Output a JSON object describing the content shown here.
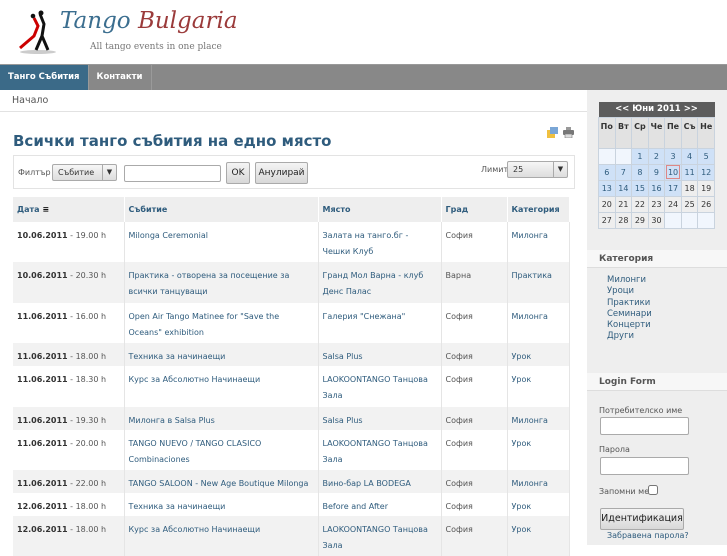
{
  "site": {
    "title_a": "Tango",
    "title_b": "Bulgaria",
    "tagline": "All tango events in one place"
  },
  "nav": [
    {
      "label": "Танго Събития",
      "active": true
    },
    {
      "label": "Контакти",
      "active": false
    }
  ],
  "breadcrumb": "Начало",
  "page_title": "Всички танго събития на едно място",
  "filter": {
    "label": "Филтър",
    "select": "Събитие",
    "input": "",
    "ok": "OK",
    "reset": "Анулирай",
    "limit_label": "Лимит",
    "limit": "25"
  },
  "table": {
    "headers": [
      "Дата",
      "Събитие",
      "Място",
      "Град",
      "Категория"
    ],
    "rows": [
      {
        "date": "10.06.2011",
        "time": "- 19.00 h",
        "event": "Milonga Ceremonial",
        "place": "Залата на танго.бг - Чешки Клуб",
        "city": "София",
        "cat": "Милонга"
      },
      {
        "date": "10.06.2011",
        "time": "- 20.30 h",
        "event": "Практика - отворена за посещение за всички танцуващи",
        "place": "Гранд Мол Варна - клуб Денс Палас",
        "city": "Варна",
        "cat": "Практика"
      },
      {
        "date": "11.06.2011",
        "time": "- 16.00 h",
        "event": "Open Air Tango Matinee for \"Save the Oceans\" exhibition",
        "place": "Галерия \"Снежана\"",
        "city": "София",
        "cat": "Милонга"
      },
      {
        "date": "11.06.2011",
        "time": "- 18.00 h",
        "event": "Техника за начинаещи",
        "place": "Salsa Plus",
        "city": "София",
        "cat": "Урок"
      },
      {
        "date": "11.06.2011",
        "time": "- 18.30 h",
        "event": "Курс за Абсолютно Начинаещи",
        "place": "LAOKOONTANGO Танцова Зала",
        "city": "София",
        "cat": "Урок"
      },
      {
        "date": "11.06.2011",
        "time": "- 19.30 h",
        "event": "Милонга в Salsa Plus",
        "place": "Salsa Plus",
        "city": "София",
        "cat": "Милонга"
      },
      {
        "date": "11.06.2011",
        "time": "- 20.00 h",
        "event": "TANGO NUEVO / TANGO CLASICO Combinaciones",
        "place": "LAOKOONTANGO Танцова Зала",
        "city": "София",
        "cat": "Урок"
      },
      {
        "date": "11.06.2011",
        "time": "- 22.00 h",
        "event": "TANGO SALOON - New Age Boutique Milonga",
        "place": "Вино-бар LA BODEGA",
        "city": "София",
        "cat": "Милонга"
      },
      {
        "date": "12.06.2011",
        "time": "- 18.00 h",
        "event": "Техника за начинаещи",
        "place": "Before and After",
        "city": "София",
        "cat": "Урок"
      },
      {
        "date": "12.06.2011",
        "time": "- 18.00 h",
        "event": "Курс за Абсолютно Начинаещи",
        "place": "LAOKOONTANGO Танцова Зала",
        "city": "София",
        "cat": "Урок"
      }
    ]
  },
  "calendar": {
    "prev": "<<",
    "month": "Юни 2011",
    "next": ">>",
    "days": [
      "По",
      "Вт",
      "Ср",
      "Че",
      "Пе",
      "Съ",
      "Не"
    ],
    "weeks": [
      [
        "",
        "",
        "1",
        "2",
        "3",
        "4",
        "5"
      ],
      [
        "6",
        "7",
        "8",
        "9",
        "10",
        "11",
        "12"
      ],
      [
        "13",
        "14",
        "15",
        "16",
        "17",
        "18",
        "19"
      ],
      [
        "20",
        "21",
        "22",
        "23",
        "24",
        "25",
        "26"
      ],
      [
        "27",
        "28",
        "29",
        "30",
        "",
        "",
        ""
      ]
    ],
    "today": "10",
    "event_days": [
      "1",
      "2",
      "3",
      "4",
      "5",
      "6",
      "7",
      "8",
      "9",
      "10",
      "11",
      "12",
      "13",
      "14",
      "15",
      "16",
      "17"
    ]
  },
  "category": {
    "title": "Категория",
    "items": [
      "Милонги",
      "Уроци",
      "Практики",
      "Семинари",
      "Концерти",
      "Други"
    ]
  },
  "login": {
    "title": "Login Form",
    "username_label": "Потребителско име",
    "password_label": "Парола",
    "remember_label": "Запомни ме",
    "submit": "Идентификация",
    "forgot": "Забравена парола?"
  }
}
